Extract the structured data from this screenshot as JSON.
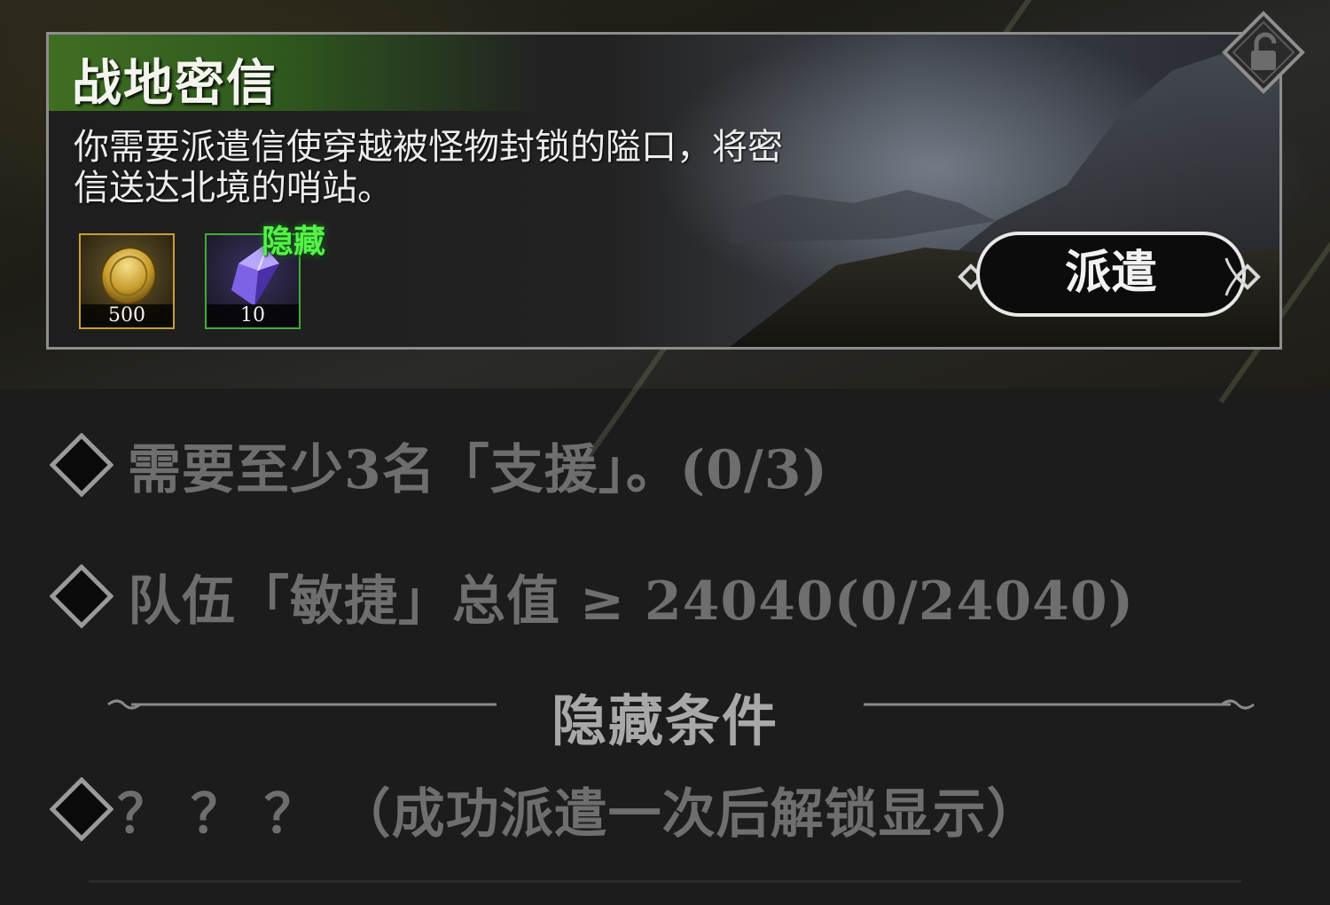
{
  "mission": {
    "title": "战地密信",
    "description_line1": "你需要派遣信使穿越被怪物封锁的隘口，将密",
    "description_line2": "信送达北境的哨站。",
    "dispatch_label": "派遣",
    "hidden_tag": "隐藏",
    "rewards": [
      {
        "icon": "gold-coin-icon",
        "count": "500",
        "frame_color": "#c8a033"
      },
      {
        "icon": "purple-crystal-icon",
        "count": "10",
        "frame_color": "#3fae3a"
      }
    ]
  },
  "conditions": [
    {
      "text": "需要至少3名「支援」。(0/3)"
    },
    {
      "text": "队伍「敏捷」总值 ≥ 24040(0/24040)"
    }
  ],
  "hidden_section": {
    "title": "隐藏条件",
    "conditions": [
      {
        "text": "？ ？ ？ （成功派遣一次后解锁显示）"
      }
    ]
  },
  "colors": {
    "title_banner": "#3f6e22",
    "hidden_tag": "#56f04a",
    "condition_text": "#6e6e6e"
  }
}
